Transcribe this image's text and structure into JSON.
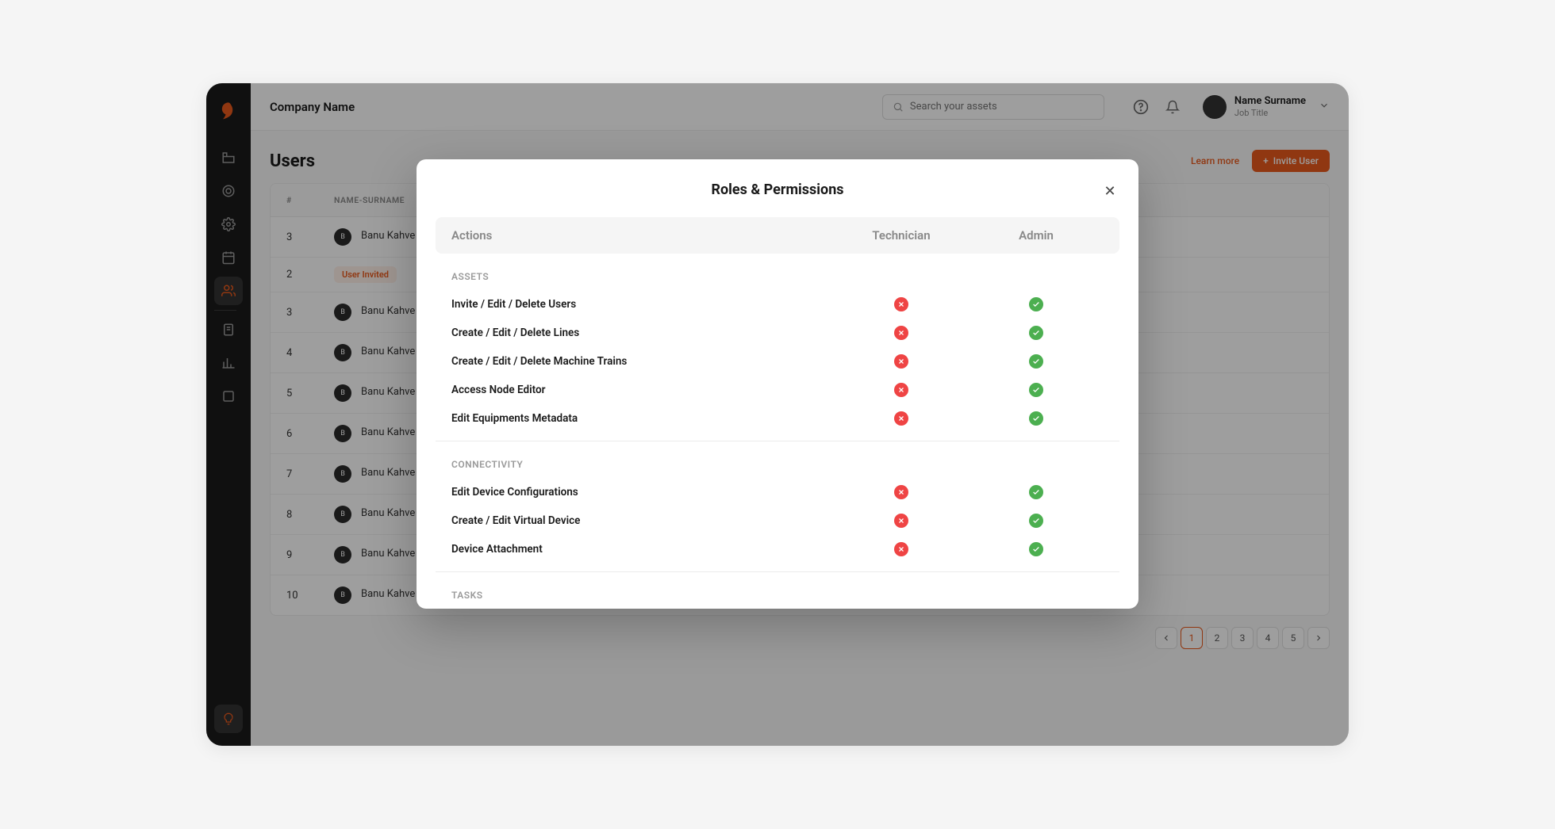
{
  "header": {
    "company": "Company Name",
    "searchPlaceholder": "Search your assets"
  },
  "user": {
    "name": "Name Surname",
    "title": "Job Title"
  },
  "page": {
    "title": "Users",
    "learnMore": "Learn more",
    "inviteLabel": "Invite User",
    "columns": {
      "index": "#",
      "name": "NAME-SURNAME"
    },
    "rows": [
      {
        "idx": "3",
        "name": "Banu Kahve",
        "initial": "B"
      },
      {
        "idx": "2",
        "badge": "User Invited"
      },
      {
        "idx": "3",
        "name": "Banu Kahve",
        "initial": "B"
      },
      {
        "idx": "4",
        "name": "Banu Kahve",
        "initial": "B"
      },
      {
        "idx": "5",
        "name": "Banu Kahve",
        "initial": "B"
      },
      {
        "idx": "6",
        "name": "Banu Kahve",
        "initial": "B"
      },
      {
        "idx": "7",
        "name": "Banu Kahve",
        "initial": "B"
      },
      {
        "idx": "8",
        "name": "Banu Kahve",
        "initial": "B"
      },
      {
        "idx": "9",
        "name": "Banu Kahve",
        "initial": "B"
      },
      {
        "idx": "10",
        "name": "Banu Kahve",
        "initial": "B"
      }
    ],
    "pagination": {
      "pages": [
        "1",
        "2",
        "3",
        "4",
        "5"
      ],
      "active": "1"
    }
  },
  "modal": {
    "title": "Roles & Permissions",
    "columns": {
      "actions": "Actions",
      "tech": "Technician",
      "admin": "Admin"
    },
    "groups": [
      {
        "label": "ASSETS",
        "rows": [
          {
            "action": "Invite / Edit / Delete Users",
            "tech": false,
            "admin": true
          },
          {
            "action": "Create / Edit / Delete Lines",
            "tech": false,
            "admin": true
          },
          {
            "action": "Create / Edit / Delete Machine Trains",
            "tech": false,
            "admin": true
          },
          {
            "action": "Access Node Editor",
            "tech": false,
            "admin": true
          },
          {
            "action": "Edit Equipments Metadata",
            "tech": false,
            "admin": true
          }
        ]
      },
      {
        "label": "CONNECTIVITY",
        "rows": [
          {
            "action": "Edit Device Configurations",
            "tech": false,
            "admin": true
          },
          {
            "action": "Create / Edit Virtual Device",
            "tech": false,
            "admin": true
          },
          {
            "action": "Device Attachment",
            "tech": false,
            "admin": true
          }
        ]
      },
      {
        "label": "TASKS",
        "rows": []
      }
    ]
  },
  "sidebarIcons": [
    "factory",
    "target",
    "gear",
    "calendar",
    "users",
    "clipboard",
    "chart",
    "box"
  ]
}
